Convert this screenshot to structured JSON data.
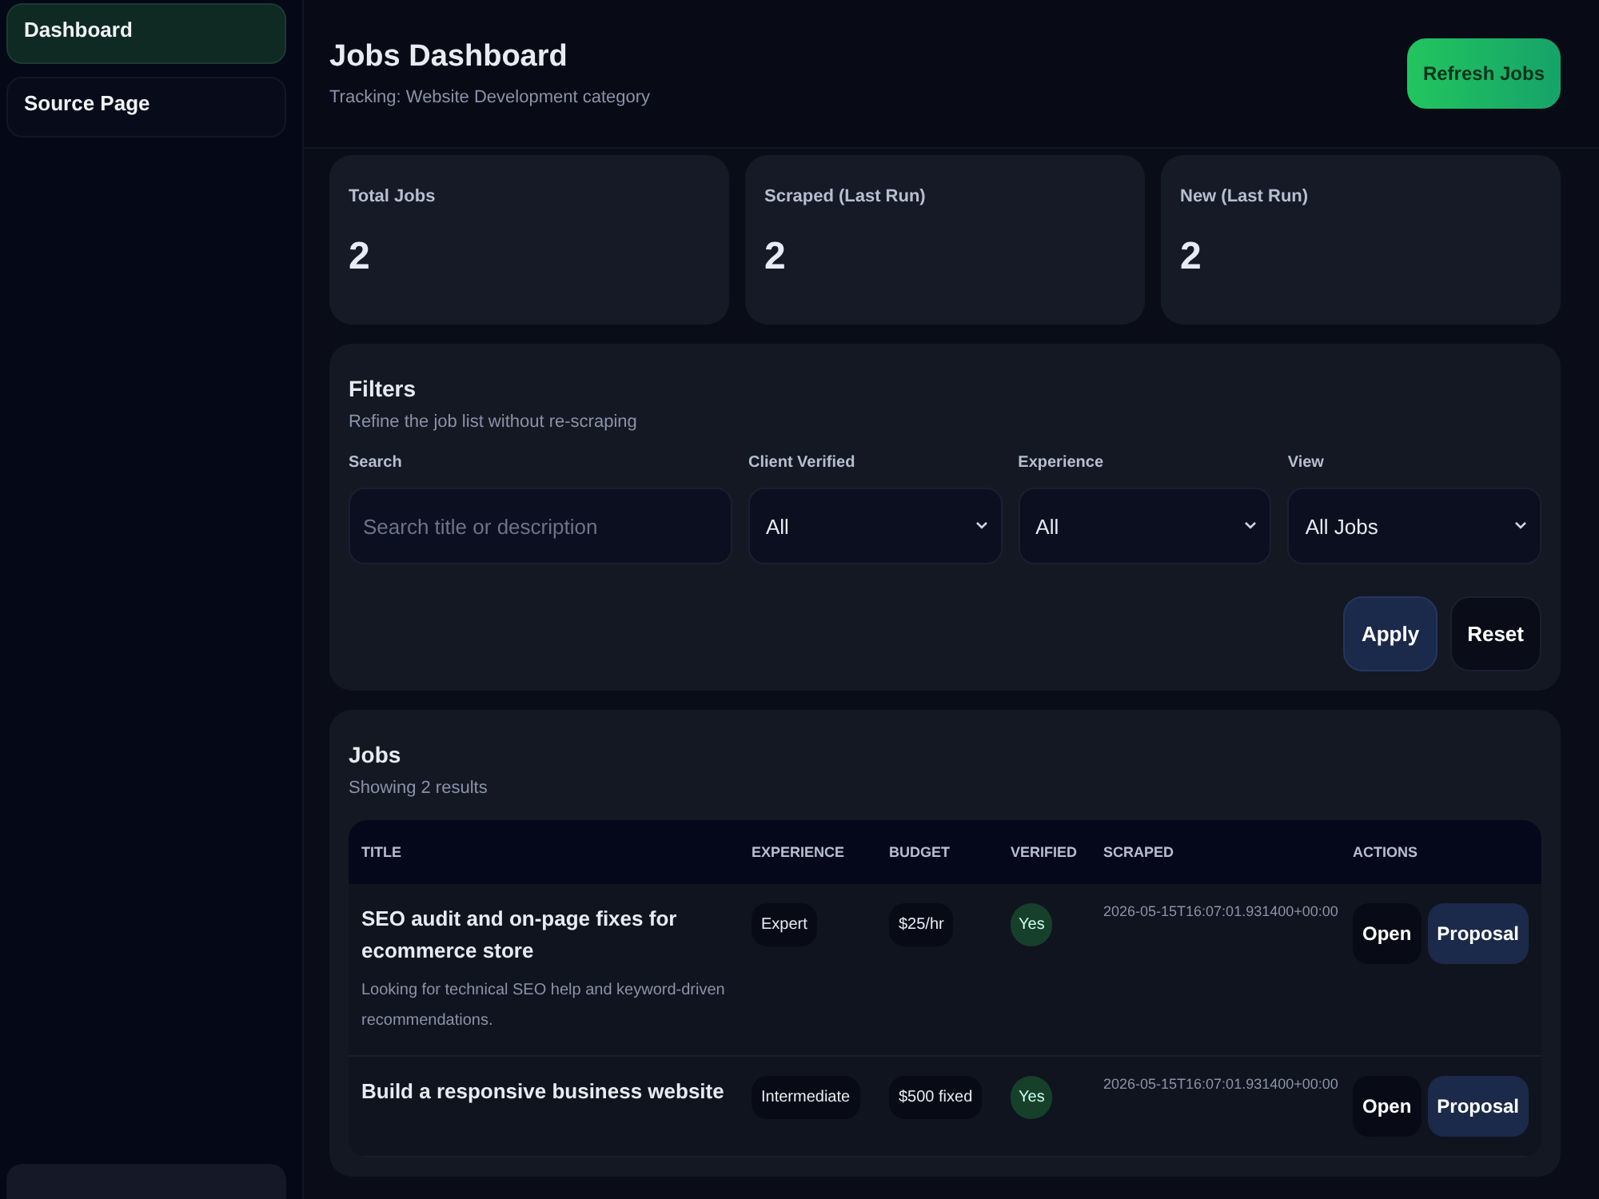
{
  "sidebar": {
    "items": [
      {
        "label": "Dashboard",
        "selected": true
      },
      {
        "label": "Source Page",
        "selected": false
      }
    ]
  },
  "header": {
    "title": "Jobs Dashboard",
    "subtitle": "Tracking: Website Development category",
    "action": "Refresh Jobs"
  },
  "stats": [
    {
      "label": "Total Jobs",
      "value": "2"
    },
    {
      "label": "Scraped (Last Run)",
      "value": "2"
    },
    {
      "label": "New (Last Run)",
      "value": "2"
    }
  ],
  "filters": {
    "title": "Filters",
    "subtitle": "Refine the job list without re-scraping",
    "search": {
      "label": "Search",
      "placeholder": "Search title or description"
    },
    "selects": [
      {
        "label": "Client Verified",
        "value": "All"
      },
      {
        "label": "Experience",
        "value": "All"
      },
      {
        "label": "View",
        "value": "All Jobs"
      }
    ],
    "buttons": [
      {
        "label": "Apply",
        "kind": "primary"
      },
      {
        "label": "Reset",
        "kind": "secondary"
      }
    ]
  },
  "jobs": {
    "title": "Jobs",
    "subtitle": "Showing 2 results",
    "columns": [
      "TITLE",
      "EXPERIENCE",
      "BUDGET",
      "VERIFIED",
      "SCRAPED",
      "ACTIONS"
    ],
    "rows": [
      {
        "title": "SEO audit and on-page fixes for ecommerce store",
        "description": "Looking for technical SEO help and keyword-driven recommendations.",
        "experience": "Expert",
        "budget": "$25/hr",
        "verified": "Yes",
        "scraped": "2026-05-15T16:07:01.931400+00:00",
        "actions": [
          "Open",
          "Proposal"
        ]
      },
      {
        "title": "Build a responsive business website",
        "description": "",
        "experience": "Intermediate",
        "budget": "$500 fixed",
        "verified": "Yes",
        "scraped": "2026-05-15T16:07:01.931400+00:00",
        "actions": [
          "Open",
          "Proposal"
        ]
      }
    ]
  }
}
